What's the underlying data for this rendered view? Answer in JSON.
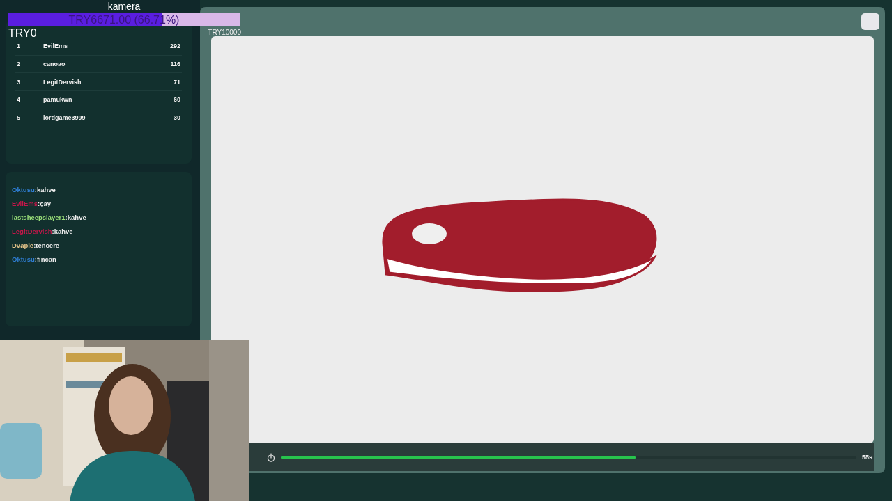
{
  "donation": {
    "title": "kamera",
    "text": "TRY6671.00 (66.71%)",
    "level": 0.6671,
    "goal": "TRY10000"
  },
  "balance": "TRY0",
  "leaderboard": [
    {
      "rank": "1",
      "name": "EvilEms",
      "score": "292"
    },
    {
      "rank": "2",
      "name": "canoao",
      "score": "116"
    },
    {
      "rank": "3",
      "name": "LegitDervish",
      "score": "71"
    },
    {
      "rank": "4",
      "name": "pamukwn",
      "score": "60"
    },
    {
      "rank": "5",
      "name": "lordgame3999",
      "score": "30"
    }
  ],
  "chat": [
    {
      "user": "Oktusu",
      "message": ":kahve",
      "color": "#2f7fd6"
    },
    {
      "user": "EvilEms",
      "message": ":çay",
      "color": "#c4174a"
    },
    {
      "user": "lastsheepslayer1",
      "message": ":kahve",
      "color": "#9be07a"
    },
    {
      "user": "LegitDervish",
      "message": ":kahve",
      "color": "#c4174a"
    },
    {
      "user": "Dvaple",
      "message": ":tencere",
      "color": "#e5c48a"
    },
    {
      "user": "Oktusu",
      "message": ":fincan",
      "color": "#2f7fd6"
    }
  ],
  "timer": {
    "level": 0.616,
    "remaining": "55s"
  }
}
